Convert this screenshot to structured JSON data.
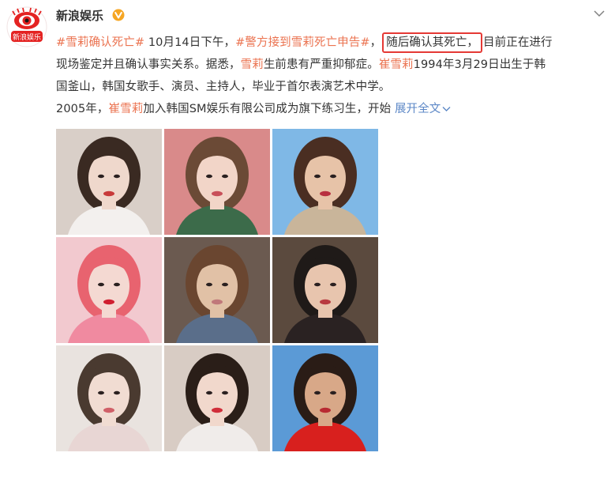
{
  "post": {
    "author": "新浪娱乐",
    "verified": true,
    "avatar_text": "新浪娱乐",
    "lines": [
      {
        "hashtag1": "#雪莉确认死亡#",
        "t1": " 10月14日下午，",
        "hashtag2": "#警方接到雪莉死亡申告#",
        "t2": "，",
        "highlight": "随后确认其死亡，",
        "t3": "目前正在进行"
      },
      {
        "t1": "现场鉴定并且确认事实关系。据悉，",
        "name": "雪莉",
        "t2": "生前患有严重抑郁症。",
        "name2": "崔雪莉",
        "t3": "1994年3月29日出生于韩"
      },
      {
        "t1": "国釜山，韩国女歌手、演员、主持人，毕业于首尔表演艺术中学。"
      },
      {
        "t1": "2005年，",
        "name": "崔雪莉",
        "t2": "加入韩国SM娱乐有限公司成为旗下练习生，开始 ",
        "expand": "展开全文"
      }
    ]
  },
  "colors": {
    "link": "#eb7350",
    "expand": "#5d88c7",
    "highlight_border": "#e53935",
    "verified": "#f6a623"
  },
  "photos": [
    {
      "name": "photo-1",
      "bg": "#d9cfc8",
      "skin": "#efd8cc",
      "hair": "#3a2a22",
      "lips": "#c83a3a",
      "shirt": "#f3f0ee"
    },
    {
      "name": "photo-2",
      "bg": "#d98a8a",
      "skin": "#f2d5c8",
      "hair": "#6b4a36",
      "lips": "#c8505a",
      "shirt": "#3c6b4a"
    },
    {
      "name": "photo-3",
      "bg": "#7fb8e6",
      "skin": "#e7c3a8",
      "hair": "#4a2e22",
      "lips": "#b83040",
      "shirt": "#c9b59a"
    },
    {
      "name": "photo-4",
      "bg": "#f2c9cf",
      "skin": "#f4d9d2",
      "hair": "#e8636f",
      "lips": "#d02030",
      "shirt": "#f08aa0"
    },
    {
      "name": "photo-5",
      "bg": "#6b5a50",
      "skin": "#e1c1a6",
      "hair": "#6a4630",
      "lips": "#c0787a",
      "shirt": "#5a6e8a"
    },
    {
      "name": "photo-6",
      "bg": "#5b4a3e",
      "skin": "#e8c5ae",
      "hair": "#1f1a18",
      "lips": "#b83a40",
      "shirt": "#2a2222"
    },
    {
      "name": "photo-7",
      "bg": "#e9e3df",
      "skin": "#f1dcd2",
      "hair": "#4a3a30",
      "lips": "#d06068",
      "shirt": "#e8d6d4"
    },
    {
      "name": "photo-8",
      "bg": "#d8ccc4",
      "skin": "#f1d8cc",
      "hair": "#2a1e18",
      "lips": "#d02e3a",
      "shirt": "#f0ecea"
    },
    {
      "name": "photo-9",
      "bg": "#5b9ad6",
      "skin": "#d8a888",
      "hair": "#2a1c16",
      "lips": "#b82a32",
      "shirt": "#d8201e"
    }
  ]
}
